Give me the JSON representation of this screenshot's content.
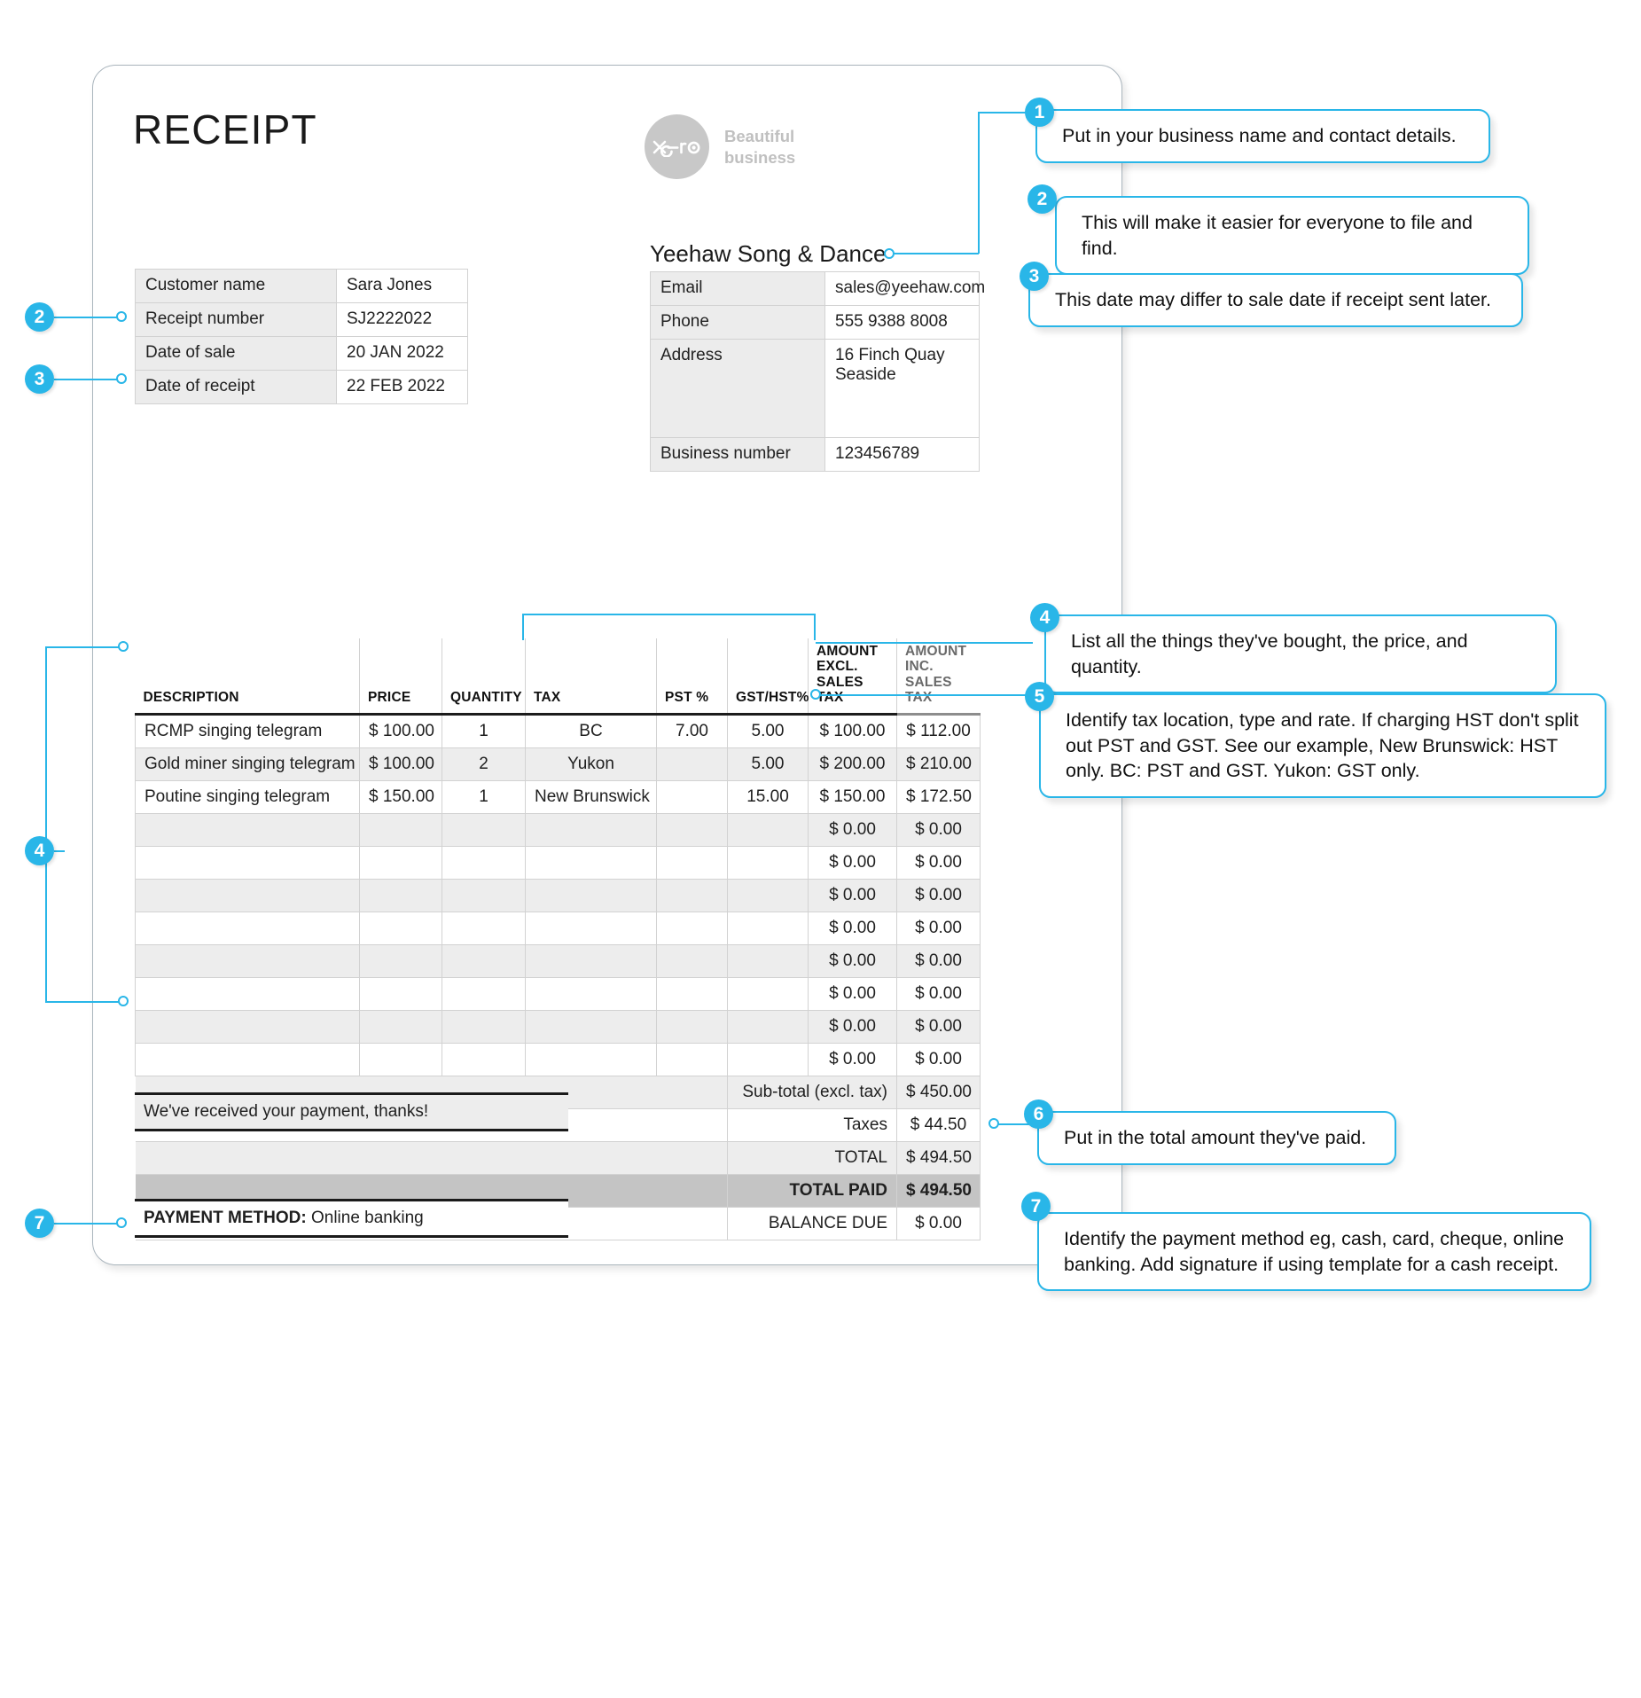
{
  "document": {
    "title": "RECEIPT"
  },
  "logo": {
    "wordmark": "xero",
    "tagline_line1": "Beautiful",
    "tagline_line2": "business",
    "color": "#c8c8c8"
  },
  "customer_details": {
    "rows": [
      {
        "label": "Customer name",
        "value": "Sara Jones"
      },
      {
        "label": "Receipt number",
        "value": "SJ2222022"
      },
      {
        "label": "Date of sale",
        "value": "20 JAN 2022"
      },
      {
        "label": "Date of receipt",
        "value": "22 FEB 2022"
      }
    ]
  },
  "business": {
    "name": "Yeehaw Song & Dance",
    "rows": [
      {
        "label": "Email",
        "value": "sales@yeehaw.com"
      },
      {
        "label": "Phone",
        "value": "555 9388 8008"
      },
      {
        "label": "Address",
        "value": "16 Finch Quay\nSeaside"
      },
      {
        "label": "Business number",
        "value": "123456789"
      }
    ]
  },
  "line_items": {
    "headers": [
      "DESCRIPTION",
      "PRICE",
      "QUANTITY",
      "TAX",
      "PST %",
      "GST/HST%",
      "AMOUNT EXCL. SALES TAX",
      "AMOUNT INC. SALES TAX"
    ],
    "header_excl_l1": "AMOUNT EXCL.",
    "header_excl_l2": "SALES TAX",
    "header_inc_l1": "AMOUNT INC.",
    "header_inc_l2": "SALES TAX",
    "rows": [
      {
        "description": "RCMP singing telegram",
        "price": "$ 100.00",
        "quantity": "1",
        "tax": "BC",
        "pst": "7.00",
        "gst": "5.00",
        "excl": "$ 100.00",
        "inc": "$ 112.00"
      },
      {
        "description": "Gold miner singing telegram",
        "price": "$ 100.00",
        "quantity": "2",
        "tax": "Yukon",
        "pst": "",
        "gst": "5.00",
        "excl": "$ 200.00",
        "inc": "$ 210.00"
      },
      {
        "description": "Poutine singing telegram",
        "price": "$ 150.00",
        "quantity": "1",
        "tax": "New Brunswick",
        "pst": "",
        "gst": "15.00",
        "excl": "$ 150.00",
        "inc": "$ 172.50"
      },
      {
        "description": "",
        "price": "",
        "quantity": "",
        "tax": "",
        "pst": "",
        "gst": "",
        "excl": "$ 0.00",
        "inc": "$ 0.00"
      },
      {
        "description": "",
        "price": "",
        "quantity": "",
        "tax": "",
        "pst": "",
        "gst": "",
        "excl": "$ 0.00",
        "inc": "$ 0.00"
      },
      {
        "description": "",
        "price": "",
        "quantity": "",
        "tax": "",
        "pst": "",
        "gst": "",
        "excl": "$ 0.00",
        "inc": "$ 0.00"
      },
      {
        "description": "",
        "price": "",
        "quantity": "",
        "tax": "",
        "pst": "",
        "gst": "",
        "excl": "$ 0.00",
        "inc": "$ 0.00"
      },
      {
        "description": "",
        "price": "",
        "quantity": "",
        "tax": "",
        "pst": "",
        "gst": "",
        "excl": "$ 0.00",
        "inc": "$ 0.00"
      },
      {
        "description": "",
        "price": "",
        "quantity": "",
        "tax": "",
        "pst": "",
        "gst": "",
        "excl": "$ 0.00",
        "inc": "$ 0.00"
      },
      {
        "description": "",
        "price": "",
        "quantity": "",
        "tax": "",
        "pst": "",
        "gst": "",
        "excl": "$ 0.00",
        "inc": "$ 0.00"
      },
      {
        "description": "",
        "price": "",
        "quantity": "",
        "tax": "",
        "pst": "",
        "gst": "",
        "excl": "$ 0.00",
        "inc": "$ 0.00"
      }
    ]
  },
  "totals": [
    {
      "label": "Sub-total (excl. tax)",
      "value": "$ 450.00"
    },
    {
      "label": "Taxes",
      "value": "$ 44.50"
    },
    {
      "label": "TOTAL",
      "value": "$ 494.50"
    },
    {
      "label": "TOTAL PAID",
      "value": "$ 494.50"
    },
    {
      "label": "BALANCE DUE",
      "value": "$ 0.00"
    }
  ],
  "footer": {
    "thanks_message": "We've received your payment, thanks!",
    "payment_method_label": "PAYMENT METHOD:",
    "payment_method_value": "Online banking"
  },
  "callouts": [
    {
      "number": "1",
      "text": "Put in your business name and contact details."
    },
    {
      "number": "2",
      "text": "This will make it easier for everyone to file and find."
    },
    {
      "number": "3",
      "text": "This date may differ to sale date if receipt sent later."
    },
    {
      "number": "4",
      "text": "List all the things they've bought, the price, and quantity."
    },
    {
      "number": "5",
      "text": "Identify tax location, type and rate. If charging HST don't split out PST and GST. See our example, New Brunswick: HST only. BC: PST and GST. Yukon: GST only."
    },
    {
      "number": "6",
      "text": "Put in the total amount they've paid."
    },
    {
      "number": "7",
      "text": "Identify the payment method eg, cash, card, cheque, online banking. Add signature if using template for a cash receipt."
    }
  ],
  "side_markers": [
    {
      "number": "2"
    },
    {
      "number": "3"
    },
    {
      "number": "4"
    },
    {
      "number": "7"
    }
  ],
  "theme": {
    "accent": "#29b6e8",
    "sheet_border": "#aab5bd",
    "table_shade": "#ededed",
    "paid_shade": "#c4c4c4"
  }
}
